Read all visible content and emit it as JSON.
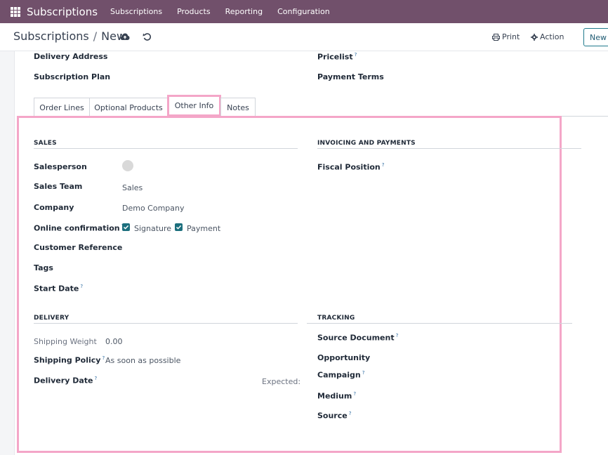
{
  "navbar": {
    "brand": "Subscriptions",
    "menu": [
      "Subscriptions",
      "Products",
      "Reporting",
      "Configuration"
    ]
  },
  "control_panel": {
    "breadcrumb_parent": "Subscriptions",
    "breadcrumb_separator": "/",
    "breadcrumb_current": "New",
    "print_label": "Print",
    "action_label": "Action",
    "new_label": "New"
  },
  "header_fields": {
    "delivery_address": "Delivery Address",
    "subscription_plan": "Subscription Plan",
    "pricelist": "Pricelist",
    "payment_terms": "Payment Terms",
    "help_mark": "?"
  },
  "tabs": [
    "Order Lines",
    "Optional Products",
    "Other Info",
    "Notes"
  ],
  "sales": {
    "title": "SALES",
    "salesperson": "Salesperson",
    "sales_team": "Sales Team",
    "sales_team_value": "Sales",
    "company": "Company",
    "company_value": "Demo Company",
    "online_confirmation": "Online confirmation",
    "signature": "Signature",
    "payment": "Payment",
    "customer_reference": "Customer Reference",
    "tags": "Tags",
    "start_date": "Start Date"
  },
  "invoicing": {
    "title": "INVOICING AND PAYMENTS",
    "fiscal_position": "Fiscal Position"
  },
  "delivery": {
    "title": "DELIVERY",
    "shipping_weight": "Shipping Weight",
    "shipping_weight_value": "0.00",
    "shipping_policy": "Shipping Policy",
    "shipping_policy_value": "As soon as possible",
    "delivery_date": "Delivery Date",
    "expected": "Expected:"
  },
  "tracking": {
    "title": "TRACKING",
    "source_document": "Source Document",
    "opportunity": "Opportunity",
    "campaign": "Campaign",
    "medium": "Medium",
    "source": "Source"
  },
  "colors": {
    "navbar": "#71506b",
    "highlight": "#f4a6c8",
    "checkbox": "#1c6f7d"
  }
}
